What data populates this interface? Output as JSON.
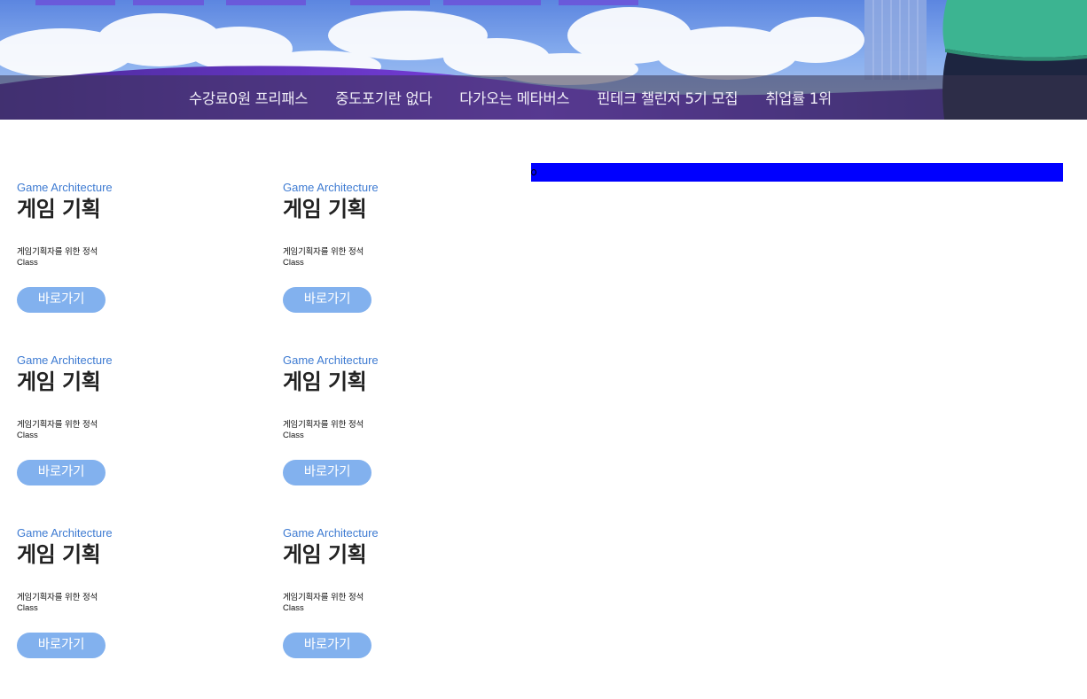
{
  "nav": {
    "items": [
      "수강료0원 프리패스",
      "중도포기란 없다",
      "다가오는 메타버스",
      "핀테크 챌린저 5기 모집",
      "취업률 1위"
    ]
  },
  "hero": {
    "image": "city-sky-clouds-banner-with-character"
  },
  "cards": [
    {
      "category": "Game Architecture",
      "title": "게임 기획",
      "desc": "게임기획자를 위한 정석",
      "sub": "Class",
      "button": "바로가기"
    },
    {
      "category": "Game Architecture",
      "title": "게임 기획",
      "desc": "게임기획자를 위한 정석",
      "sub": "Class",
      "button": "바로가기"
    },
    {
      "category": "Game Architecture",
      "title": "게임 기획",
      "desc": "게임기획자를 위한 정석",
      "sub": "Class",
      "button": "바로가기"
    },
    {
      "category": "Game Architecture",
      "title": "게임 기획",
      "desc": "게임기획자를 위한 정석",
      "sub": "Class",
      "button": "바로가기"
    },
    {
      "category": "Game Architecture",
      "title": "게임 기획",
      "desc": "게임기획자를 위한 정석",
      "sub": "Class",
      "button": "바로가기"
    },
    {
      "category": "Game Architecture",
      "title": "게임 기획",
      "desc": "게임기획자를 위한 정석",
      "sub": "Class",
      "button": "바로가기"
    }
  ],
  "colors": {
    "accent_link": "#3e7bd2",
    "button_bg": "#82b1ee",
    "blue_bar": "#0000ff",
    "nav_strip": "#3a344e"
  }
}
